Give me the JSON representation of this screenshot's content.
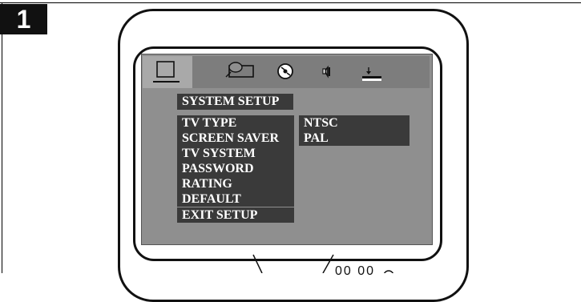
{
  "step": {
    "number": "1"
  },
  "setup_menu": {
    "tabs": [
      {
        "name": "system-setup-tab",
        "icon": "monitor-icon",
        "selected": true
      },
      {
        "name": "tv-display-tab",
        "icon": "tv-screen-icon",
        "selected": false
      },
      {
        "name": "audio-tab",
        "icon": "disc-icon",
        "selected": false
      },
      {
        "name": "speaker-tab",
        "icon": "speaker-icon",
        "selected": false
      },
      {
        "name": "digital-tab",
        "icon": "download-icon",
        "selected": false
      }
    ],
    "title": "SYSTEM SETUP",
    "items": [
      "TV TYPE",
      "SCREEN  SAVER",
      "TV SYSTEM",
      "PASSWORD",
      "RATING",
      "DEFAULT",
      "EXIT SETUP"
    ],
    "options": [
      "NTSC",
      "PAL"
    ]
  },
  "partial_text": "00 00"
}
